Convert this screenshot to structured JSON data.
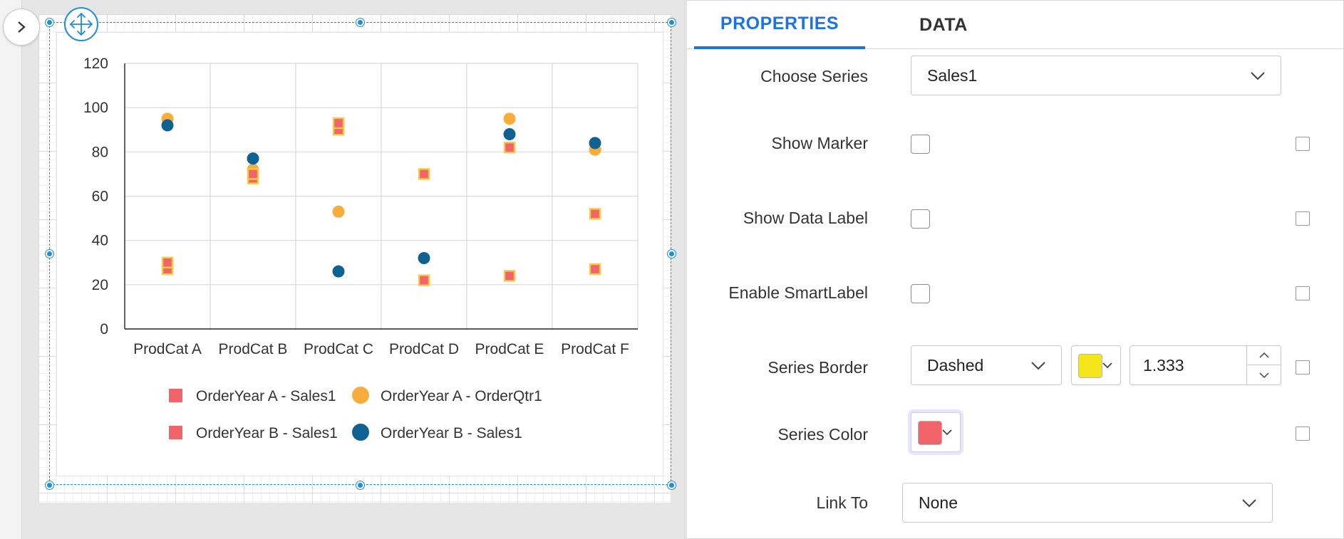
{
  "tabs": [
    {
      "label": "PROPERTIES",
      "active": true
    },
    {
      "label": "DATA",
      "active": false
    }
  ],
  "properties": {
    "choose_series": {
      "label": "Choose Series",
      "value": "Sales1"
    },
    "show_marker": {
      "label": "Show Marker",
      "checked": false
    },
    "show_data_label": {
      "label": "Show Data Label",
      "checked": false
    },
    "enable_smart_label": {
      "label": "Enable SmartLabel",
      "checked": false
    },
    "series_border": {
      "label": "Series Border",
      "style": "Dashed",
      "color": "#f5e61c",
      "width": "1.333"
    },
    "series_color": {
      "label": "Series Color",
      "color": "#f0646a"
    },
    "link_to": {
      "label": "Link To",
      "value": "None"
    }
  },
  "icons": {
    "expand": "chevron-right-icon",
    "move": "move-icon",
    "dropdown": "chevron-down-icon",
    "spin_up": "chevron-up-icon",
    "spin_down": "chevron-down-icon"
  },
  "colors": {
    "accent": "#1a73e8",
    "selection": "#1e8fd5",
    "series_square": "#f0646a",
    "series_square_border": "#f7c948",
    "series_orange": "#f7ac3c",
    "series_navy": "#0f6191"
  },
  "chart_data": {
    "type": "scatter",
    "categories": [
      "ProdCat A",
      "ProdCat B",
      "ProdCat C",
      "ProdCat D",
      "ProdCat E",
      "ProdCat F"
    ],
    "ylim": [
      0,
      120
    ],
    "yticks": [
      0,
      20,
      40,
      60,
      80,
      100,
      120
    ],
    "grid": true,
    "legend_position": "bottom",
    "series": [
      {
        "name": "OrderYear A - Sales1",
        "marker": "square",
        "values": [
          27,
          68,
          90,
          70,
          82,
          27
        ]
      },
      {
        "name": "OrderYear A - OrderQtr1",
        "marker": "circle",
        "values": [
          95,
          72,
          53,
          null,
          95,
          81
        ]
      },
      {
        "name": "OrderYear B - Sales1",
        "marker": "square",
        "values": [
          30,
          70,
          93,
          22,
          24,
          52
        ]
      },
      {
        "name": "OrderYear B - Sales1",
        "marker": "circle",
        "values": [
          92,
          77,
          26,
          32,
          88,
          84
        ]
      }
    ]
  }
}
